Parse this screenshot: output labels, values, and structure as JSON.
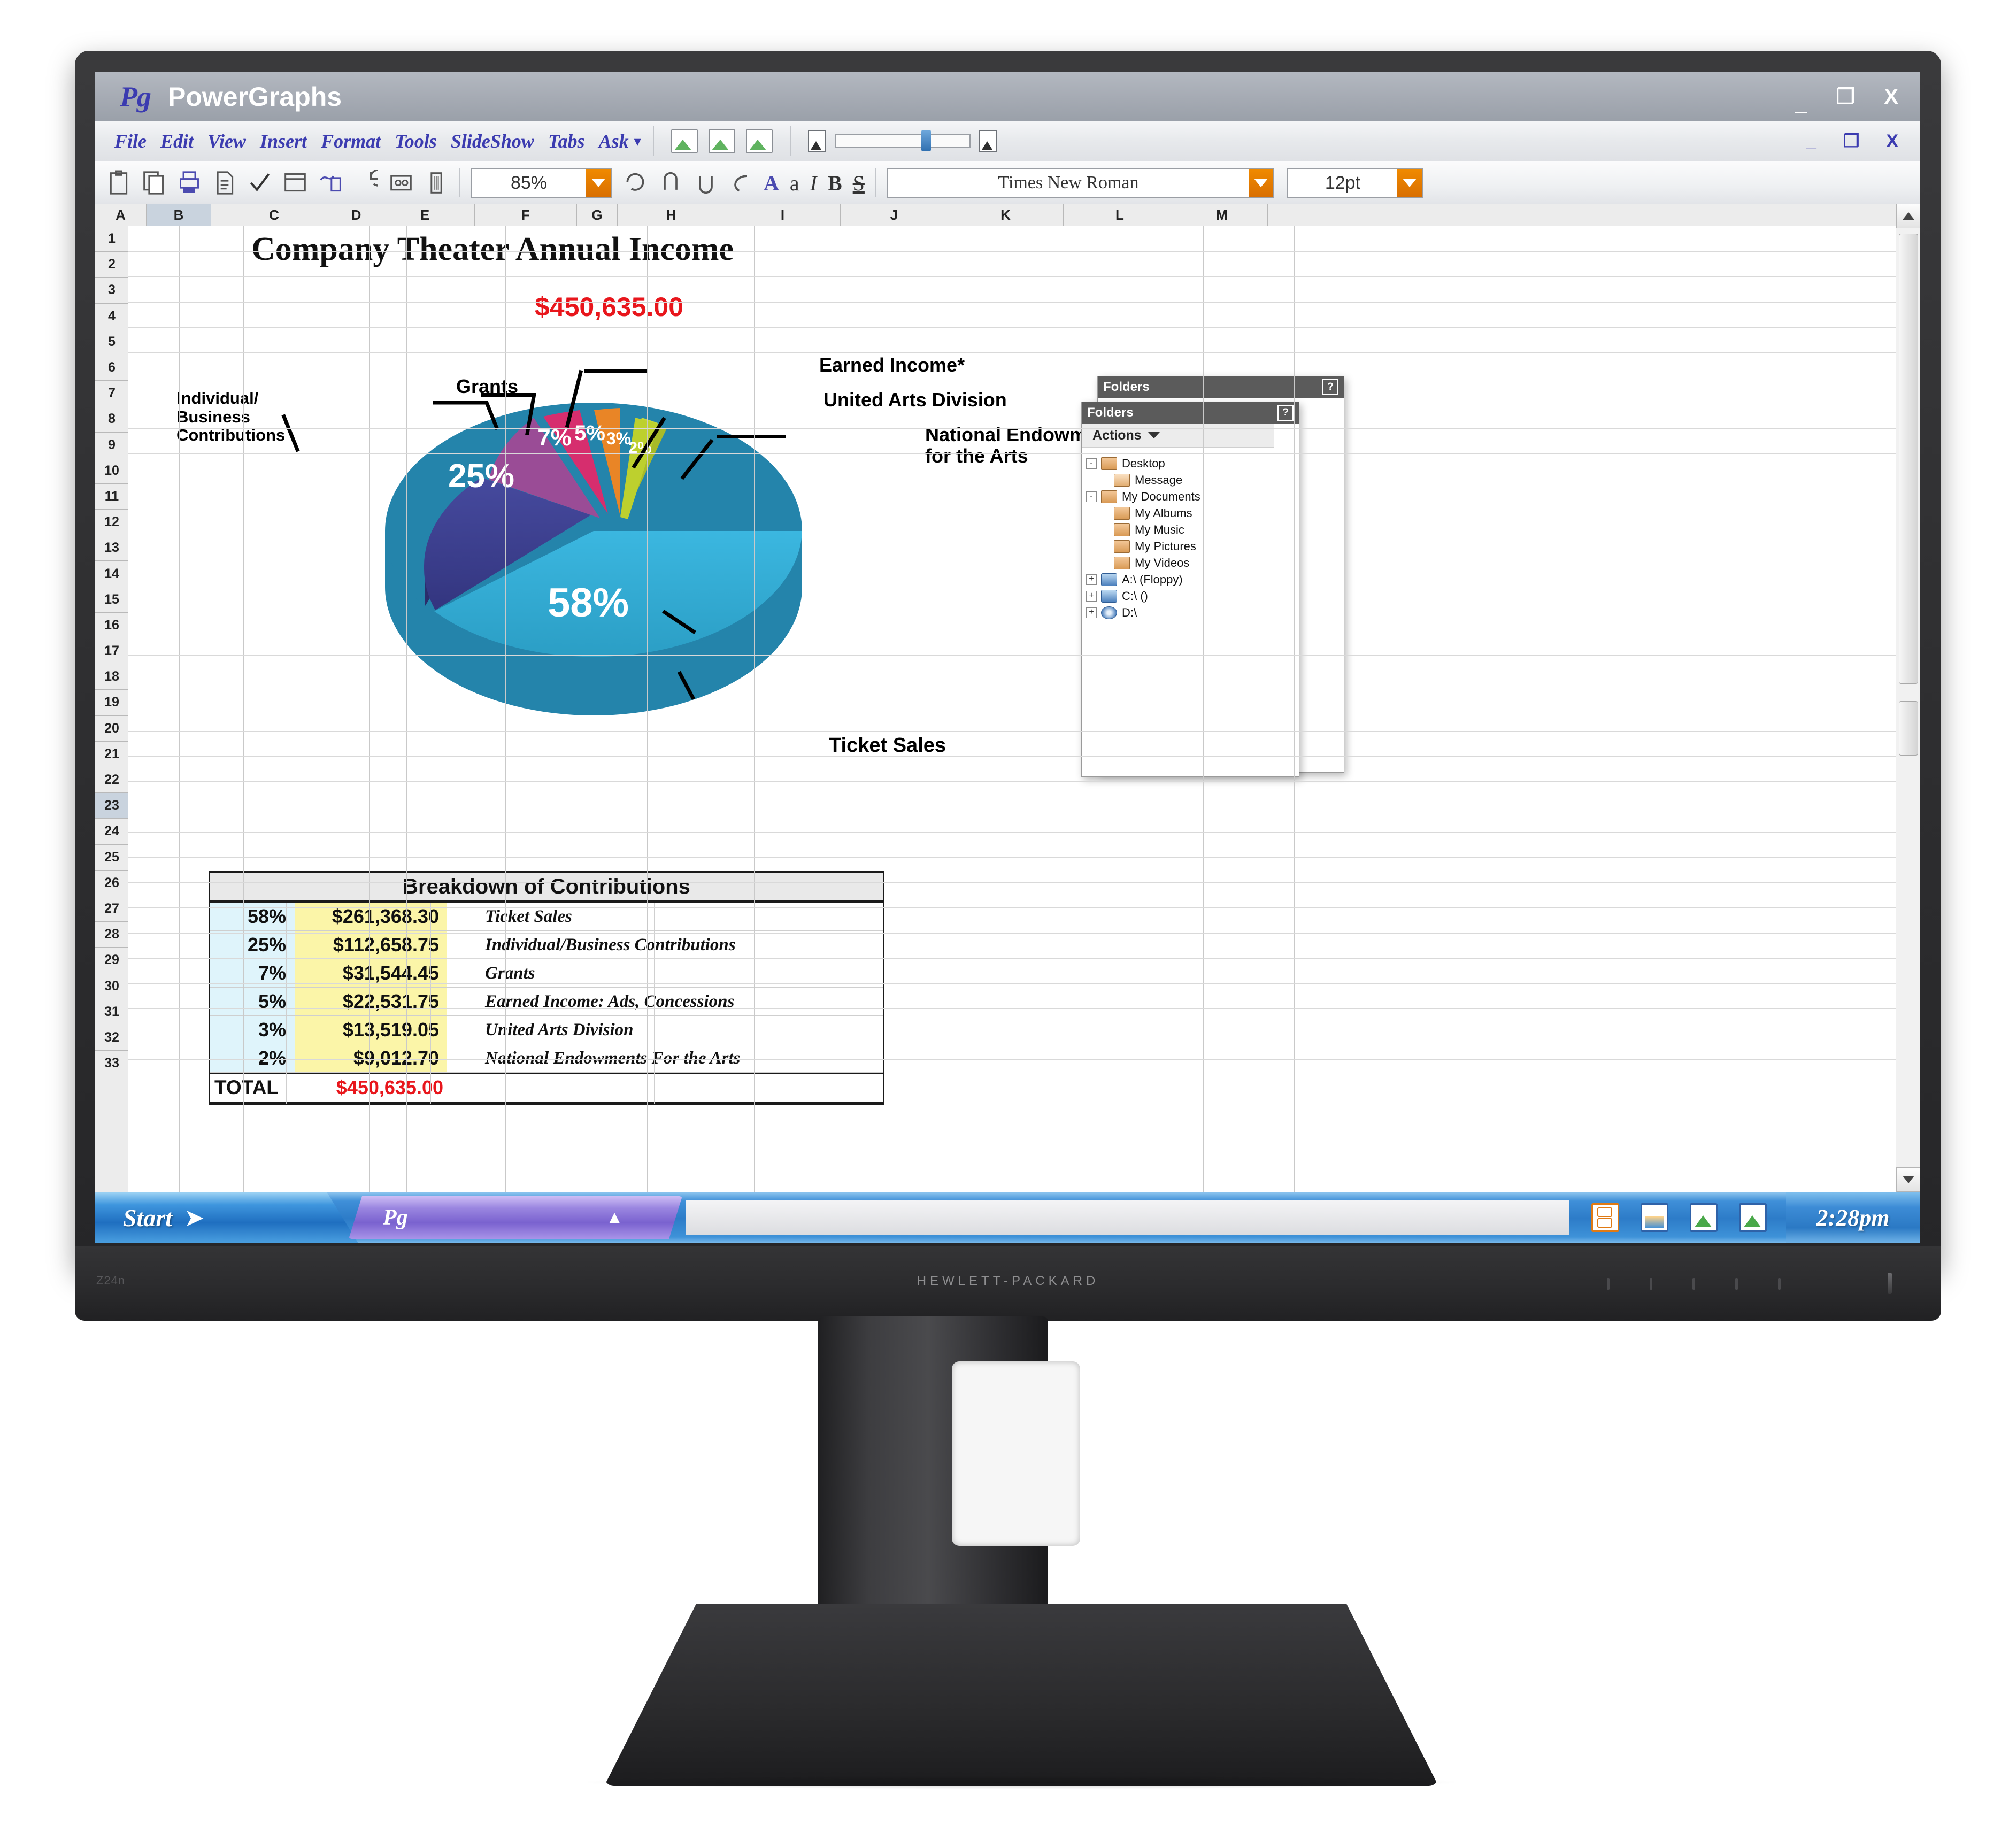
{
  "monitor": {
    "model_label": "Z24n",
    "brand_label": "HEWLETT-PACKARD"
  },
  "window": {
    "logo": "Pg",
    "title": "PowerGraphs",
    "minimize": "_",
    "restore": "❐",
    "close": "X"
  },
  "menubar": {
    "items": [
      "File",
      "Edit",
      "View",
      "Insert",
      "Format",
      "Tools",
      "SlideShow",
      "Tabs",
      "Ask"
    ],
    "caret": "▾",
    "minimize": "_",
    "restore": "❐",
    "close": "X"
  },
  "toolbar": {
    "zoom_value": "85%",
    "font_name": "Times New Roman",
    "font_size": "12pt",
    "format_icons": [
      "A",
      "a",
      "I",
      "B",
      "S"
    ],
    "icon_names": [
      "clipboard-icon",
      "copy-icon",
      "print-icon",
      "document-icon",
      "check-icon",
      "window-icon",
      "paint-icon",
      "undo-rotate-icon",
      "camera-icon",
      "delete-icon"
    ]
  },
  "sheet": {
    "columns": [
      "A",
      "B",
      "C",
      "D",
      "E",
      "F",
      "G",
      "H",
      "I",
      "J",
      "K",
      "L",
      "M"
    ],
    "selected_column": "B",
    "selected_row": "23",
    "rows": [
      "1",
      "2",
      "3",
      "4",
      "5",
      "6",
      "7",
      "8",
      "9",
      "10",
      "11",
      "12",
      "13",
      "14",
      "15",
      "16",
      "17",
      "18",
      "19",
      "20",
      "21",
      "22",
      "23",
      "24",
      "25",
      "26",
      "27",
      "28",
      "29",
      "30",
      "31",
      "32",
      "33"
    ],
    "title": "Company Theater Annual Income",
    "total_top": "$450,635.00"
  },
  "chart_data": {
    "type": "pie",
    "title": "Company Theater Annual Income",
    "total": "$450,635.00",
    "legend_position": "callouts",
    "categories": [
      "Ticket Sales",
      "Individual/Business Contributions",
      "Grants",
      "Earned Income*",
      "United Arts Division",
      "National Endowment for the Arts"
    ],
    "values": [
      58,
      25,
      7,
      5,
      3,
      2
    ],
    "value_labels": [
      "58%",
      "25%",
      "7%",
      "5%",
      "3%",
      "2%"
    ],
    "amounts": [
      "$261,368.30",
      "$112,658.75",
      "$31,544.45",
      "$22,531.75",
      "$13,519.05",
      "$9,012.70"
    ],
    "colors": [
      "#31a9d6",
      "#3e4095",
      "#9c4b96",
      "#d62e6e",
      "#e98526",
      "#bdd02e"
    ],
    "callouts": [
      {
        "label": "Grants",
        "value": "7%"
      },
      {
        "label": "Earned Income*",
        "value": "5%"
      },
      {
        "label": "United Arts Division",
        "value": "3%"
      },
      {
        "label": "National Endowment\nfor the Arts",
        "value": "2%"
      },
      {
        "label": "Individual/\nBusiness\nContributions",
        "value": "25%"
      },
      {
        "label": "Ticket Sales",
        "value": "58%"
      }
    ],
    "callout_individual_l1": "Individual/",
    "callout_individual_l2": "Business",
    "callout_individual_l3": "Contributions",
    "callout_grants": "Grants",
    "callout_earned": "Earned Income*",
    "callout_united": "United Arts Division",
    "callout_nea_l1": "National Endowment",
    "callout_nea_l2": "for the Arts",
    "callout_ticket": "Ticket Sales",
    "slice_58": "58%",
    "slice_25": "25%",
    "slice_7": "7%",
    "slice_5": "5%",
    "slice_3": "3%",
    "slice_2": "2%"
  },
  "breakdown": {
    "header": "Breakdown of Contributions",
    "rows": [
      {
        "pct": "58%",
        "amount": "$261,368.30",
        "label": "Ticket Sales"
      },
      {
        "pct": "25%",
        "amount": "$112,658.75",
        "label": "Individual/Business Contributions"
      },
      {
        "pct": "7%",
        "amount": "$31,544.45",
        "label": "Grants"
      },
      {
        "pct": "5%",
        "amount": "$22,531.75",
        "label": "Earned Income: Ads, Concessions"
      },
      {
        "pct": "3%",
        "amount": "$13,519.05",
        "label": "United Arts Division"
      },
      {
        "pct": "2%",
        "amount": "$9,012.70",
        "label": "National Endowments For the Arts"
      }
    ],
    "total_label": "TOTAL",
    "total_amount": "$450,635.00"
  },
  "folders_back": {
    "title": "Folders",
    "help": "?"
  },
  "folders_front": {
    "title": "Folders",
    "help": "?",
    "actions_label": "Actions",
    "tree": [
      {
        "label": "Desktop",
        "toggle": "-",
        "icon": "folder",
        "depth": 0
      },
      {
        "label": "Message",
        "toggle": "",
        "icon": "folder-open",
        "depth": 1
      },
      {
        "label": "My Documents",
        "toggle": "-",
        "icon": "folder",
        "depth": 0
      },
      {
        "label": "My Albums",
        "toggle": "",
        "icon": "folder",
        "depth": 1
      },
      {
        "label": "My Music",
        "toggle": "",
        "icon": "folder",
        "depth": 1
      },
      {
        "label": "My Pictures",
        "toggle": "",
        "icon": "folder",
        "depth": 1
      },
      {
        "label": "My Videos",
        "toggle": "",
        "icon": "folder",
        "depth": 1
      },
      {
        "label": "A:\\ (Floppy)",
        "toggle": "+",
        "icon": "drive",
        "depth": 0
      },
      {
        "label": "C:\\ ()",
        "toggle": "+",
        "icon": "drive",
        "depth": 0
      },
      {
        "label": "D:\\",
        "toggle": "+",
        "icon": "cd-drive",
        "depth": 0
      }
    ]
  },
  "taskbar": {
    "start_label": "Start",
    "start_arrow": "➤",
    "task_label": "Pg",
    "task_up": "▲",
    "clock": "2:28pm",
    "tray_icons": [
      "media-player-icon",
      "folder-image-icon",
      "presentation-icon",
      "image-clock-icon"
    ]
  }
}
